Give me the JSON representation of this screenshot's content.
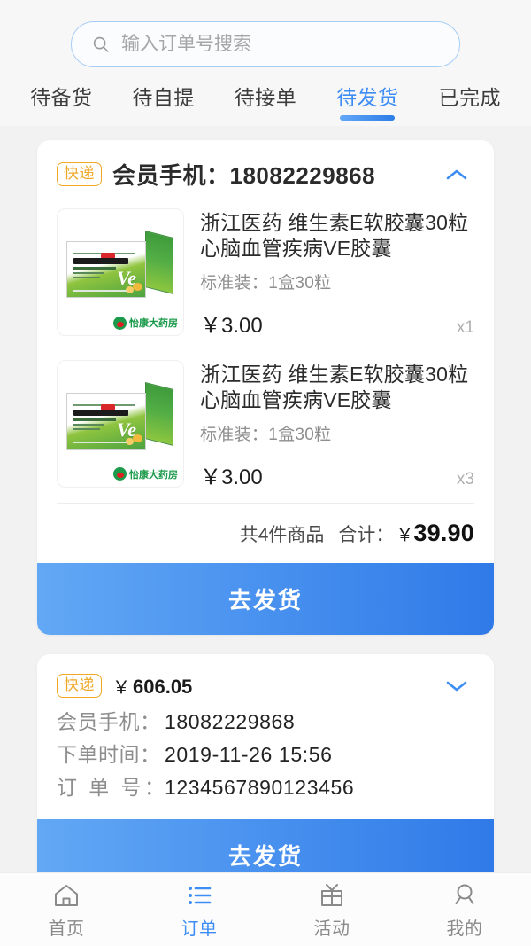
{
  "search": {
    "placeholder": "输入订单号搜索",
    "value": "",
    "icon": "search-icon"
  },
  "tabs": [
    {
      "label": "待备货",
      "active": false
    },
    {
      "label": "待自提",
      "active": false
    },
    {
      "label": "待接单",
      "active": false
    },
    {
      "label": "待发货",
      "active": true
    },
    {
      "label": "已完成",
      "active": false
    }
  ],
  "colors": {
    "accent": "#3d8df5",
    "badge": "#f0a828",
    "page_bg": "#f2f2f2",
    "card_bg": "#ffffff",
    "button_gradient_from": "#62a8f5",
    "button_gradient_to": "#2f7ae8"
  },
  "orders": [
    {
      "expanded": true,
      "badge": "快递",
      "header_label": "会员手机：",
      "header_value": "18082229868",
      "collapse_icon": "chevron-up-icon",
      "items": [
        {
          "title": "浙江医药  维生素E软胶囊30粒\n心脑血管疾病VE胶囊",
          "spec": "标准装：1盒30粒",
          "price": "￥3.00",
          "qty": "x1",
          "thumb_alt": "维生素E软胶囊 包装盒",
          "thumb_text_main": "维生素E软胶囊",
          "thumb_text_sub": "Vitamin E Soft Capsules",
          "thumb_ve": "Ve",
          "thumb_otc": "OTC",
          "pharmacy": "怡康大药房"
        },
        {
          "title": "浙江医药  维生素E软胶囊30粒\n心脑血管疾病VE胶囊",
          "spec": "标准装：1盒30粒",
          "price": "￥3.00",
          "qty": "x3",
          "thumb_alt": "维生素E软胶囊 包装盒",
          "thumb_text_main": "维生素E软胶囊",
          "thumb_text_sub": "Vitamin E Soft Capsules",
          "thumb_ve": "Ve",
          "thumb_otc": "OTC",
          "pharmacy": "怡康大药房"
        }
      ],
      "summary": {
        "count_text": "共4件商品",
        "total_label": "合计：",
        "currency": "￥",
        "total_amount": "39.90"
      },
      "action_label": "去发货"
    },
    {
      "expanded": false,
      "badge": "快递",
      "header_currency": "￥",
      "header_price": "606.05",
      "collapse_icon": "chevron-down-icon",
      "info": [
        {
          "key": "会员手机：",
          "value": "18082229868",
          "spread": false
        },
        {
          "key": "下单时间：",
          "value": "2019-11-26 15:56",
          "spread": false
        },
        {
          "key": "订 单 号：",
          "value": "1234567890123456",
          "spread": true
        }
      ],
      "action_label": "去发货"
    }
  ],
  "tabbar": [
    {
      "label": "首页",
      "icon": "home-icon",
      "active": false
    },
    {
      "label": "订单",
      "icon": "order-list-icon",
      "active": true
    },
    {
      "label": "活动",
      "icon": "gift-icon",
      "active": false
    },
    {
      "label": "我的",
      "icon": "person-icon",
      "active": false
    }
  ]
}
